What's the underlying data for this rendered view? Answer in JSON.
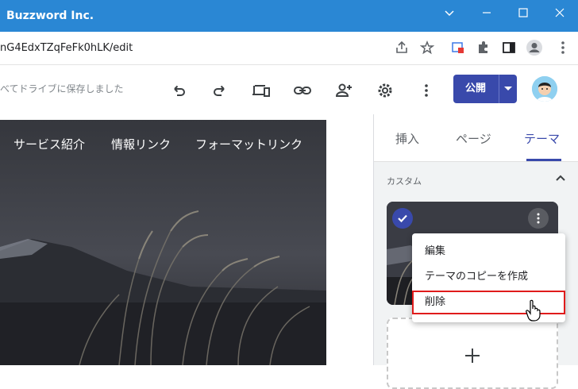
{
  "window": {
    "title": "Buzzword Inc."
  },
  "browser": {
    "url": "nG4EdxTZqFeFk0hLK/edit"
  },
  "editor": {
    "save_status": "べてドライブに保存しました",
    "publish_label": "公開"
  },
  "site_nav": {
    "links": [
      "サービス紹介",
      "情報リンク",
      "フォーマットリンク"
    ]
  },
  "side_panel": {
    "tabs": [
      "挿入",
      "ページ",
      "テーマ"
    ],
    "active_tab": "テーマ",
    "section_title": "カスタム"
  },
  "context_menu": {
    "items": [
      "編集",
      "テーマのコピーを作成",
      "削除"
    ],
    "highlighted": "削除"
  },
  "colors": {
    "titlebar": "#2a87d4",
    "accent": "#3949ab",
    "highlight_border": "#e01b1b"
  },
  "icons": [
    "minimize-icon",
    "maximize-icon",
    "close-icon",
    "chevron-down-icon",
    "share-icon",
    "star-icon",
    "extension-icon",
    "puzzle-icon",
    "sidepanel-icon",
    "profile-icon",
    "more-vert-icon",
    "undo-icon",
    "redo-icon",
    "preview-devices-icon",
    "link-icon",
    "add-person-icon",
    "gear-icon",
    "check-icon",
    "plus-icon",
    "collapse-icon",
    "hand-cursor-icon"
  ]
}
